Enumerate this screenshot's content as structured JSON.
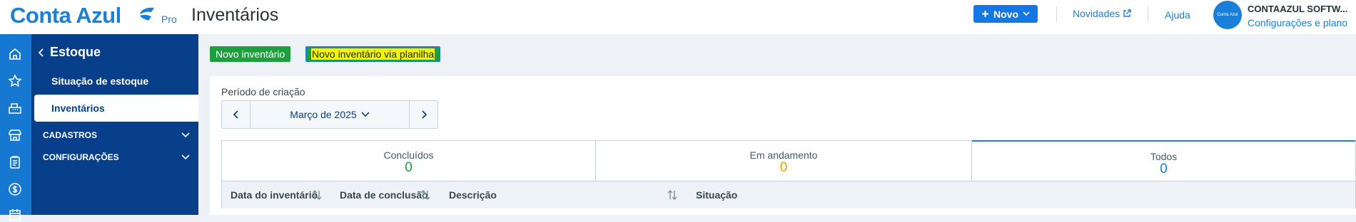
{
  "header": {
    "logo_text": "Conta Azul",
    "logo_badge": "Pro",
    "page_title": "Inventários",
    "new_button_label": "Novo",
    "news_label": "Novidades",
    "help_label": "Ajuda",
    "avatar_text": "Conta Azul",
    "company_name": "CONTAAZUL SOFTW...",
    "settings_link": "Configurações e plano"
  },
  "iconbar": {
    "icons": [
      "home-icon",
      "star-icon",
      "cash-register-icon",
      "store-icon",
      "clipboard-icon",
      "dollar-icon",
      "calendar-icon"
    ]
  },
  "sidebar": {
    "back_label": "Estoque",
    "items": [
      {
        "label": "Situação de estoque",
        "active": false
      },
      {
        "label": "Inventários",
        "active": true
      }
    ],
    "sections": [
      {
        "label": "CADASTROS"
      },
      {
        "label": "CONFIGURAÇÕES"
      }
    ]
  },
  "actions": {
    "new_inventory": "Novo inventário",
    "new_inventory_sheet": "Novo inventário via planilha"
  },
  "filter": {
    "period_label": "Período de criação",
    "period_value": "Março de 2025"
  },
  "tabs": [
    {
      "label": "Concluídos",
      "count": "0",
      "color": "#1e9e3e"
    },
    {
      "label": "Em andamento",
      "count": "0",
      "color": "#f5a000"
    },
    {
      "label": "Todos",
      "count": "0",
      "color": "#1a7fd8",
      "active": true
    }
  ],
  "table": {
    "columns": [
      "Data do inventário",
      "Data de conclusão",
      "Descrição",
      "Situação"
    ]
  },
  "colors": {
    "brand": "#1a7fd8",
    "sidebar": "#083f8a",
    "success": "#1e9e3e"
  }
}
